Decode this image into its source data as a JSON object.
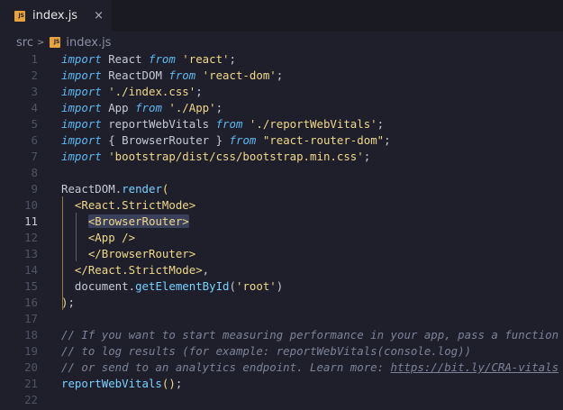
{
  "tab": {
    "label": "index.js",
    "close": "×",
    "icon_text": "JS"
  },
  "breadcrumb": {
    "folder": "src",
    "separator": ">",
    "file": "index.js"
  },
  "editor": {
    "active_line": 11,
    "lines": [
      {
        "n": "1",
        "tokens": [
          [
            "kw",
            "import"
          ],
          [
            "id",
            " React "
          ],
          [
            "kw",
            "from"
          ],
          [
            "str",
            " 'react'"
          ],
          [
            "pn",
            ";"
          ]
        ]
      },
      {
        "n": "2",
        "tokens": [
          [
            "kw",
            "import"
          ],
          [
            "id",
            " ReactDOM "
          ],
          [
            "kw",
            "from"
          ],
          [
            "str",
            " 'react-dom'"
          ],
          [
            "pn",
            ";"
          ]
        ]
      },
      {
        "n": "3",
        "tokens": [
          [
            "kw",
            "import"
          ],
          [
            "str",
            " './index.css'"
          ],
          [
            "pn",
            ";"
          ]
        ]
      },
      {
        "n": "4",
        "tokens": [
          [
            "kw",
            "import"
          ],
          [
            "id",
            " App "
          ],
          [
            "kw",
            "from"
          ],
          [
            "str",
            " './App'"
          ],
          [
            "pn",
            ";"
          ]
        ]
      },
      {
        "n": "5",
        "tokens": [
          [
            "kw",
            "import"
          ],
          [
            "id",
            " reportWebVitals "
          ],
          [
            "kw",
            "from"
          ],
          [
            "str",
            " './reportWebVitals'"
          ],
          [
            "pn",
            ";"
          ]
        ]
      },
      {
        "n": "6",
        "tokens": [
          [
            "kw",
            "import"
          ],
          [
            "pn",
            " { "
          ],
          [
            "id",
            "BrowserRouter"
          ],
          [
            "pn",
            " } "
          ],
          [
            "kw",
            "from"
          ],
          [
            "str",
            " \"react-router-dom\""
          ],
          [
            "pn",
            ";"
          ]
        ]
      },
      {
        "n": "7",
        "tokens": [
          [
            "kw",
            "import"
          ],
          [
            "str",
            " 'bootstrap/dist/css/bootstrap.min.css'"
          ],
          [
            "pn",
            ";"
          ]
        ]
      },
      {
        "n": "8",
        "tokens": []
      },
      {
        "n": "9",
        "tokens": [
          [
            "id",
            "ReactDOM"
          ],
          [
            "pn",
            "."
          ],
          [
            "fn",
            "render"
          ],
          [
            "tag",
            "("
          ]
        ]
      },
      {
        "n": "10",
        "tokens": [
          [
            "pn",
            "  "
          ],
          [
            "tag",
            "<React.StrictMode>"
          ]
        ]
      },
      {
        "n": "11",
        "tokens": [
          [
            "pn",
            "    "
          ],
          [
            "tag",
            "<BrowserRouter>",
            "hl"
          ]
        ]
      },
      {
        "n": "12",
        "tokens": [
          [
            "pn",
            "    "
          ],
          [
            "tag",
            "<App />"
          ]
        ]
      },
      {
        "n": "13",
        "tokens": [
          [
            "pn",
            "    "
          ],
          [
            "tag",
            "</BrowserRouter>"
          ]
        ]
      },
      {
        "n": "14",
        "tokens": [
          [
            "pn",
            "  "
          ],
          [
            "tag",
            "</React.StrictMode>"
          ],
          [
            "pn",
            ","
          ]
        ]
      },
      {
        "n": "15",
        "tokens": [
          [
            "pn",
            "  "
          ],
          [
            "id",
            "document"
          ],
          [
            "pn",
            "."
          ],
          [
            "fn",
            "getElementById"
          ],
          [
            "pn",
            "("
          ],
          [
            "str",
            "'root'"
          ],
          [
            "pn",
            ")"
          ]
        ]
      },
      {
        "n": "16",
        "tokens": [
          [
            "tag",
            ")"
          ],
          [
            "pn",
            ";"
          ]
        ]
      },
      {
        "n": "17",
        "tokens": []
      },
      {
        "n": "18",
        "tokens": [
          [
            "cm",
            "// If you want to start measuring performance in your app, pass a function"
          ]
        ]
      },
      {
        "n": "19",
        "tokens": [
          [
            "cm",
            "// to log results (for example: reportWebVitals(console.log))"
          ]
        ]
      },
      {
        "n": "20",
        "tokens": [
          [
            "cm",
            "// or send to an analytics endpoint. Learn more: "
          ],
          [
            "lnk",
            "https://bit.ly/CRA-vitals"
          ]
        ]
      },
      {
        "n": "21",
        "tokens": [
          [
            "fn",
            "reportWebVitals"
          ],
          [
            "tag",
            "()"
          ],
          [
            "pn",
            ";"
          ]
        ]
      },
      {
        "n": "22",
        "tokens": []
      }
    ]
  }
}
